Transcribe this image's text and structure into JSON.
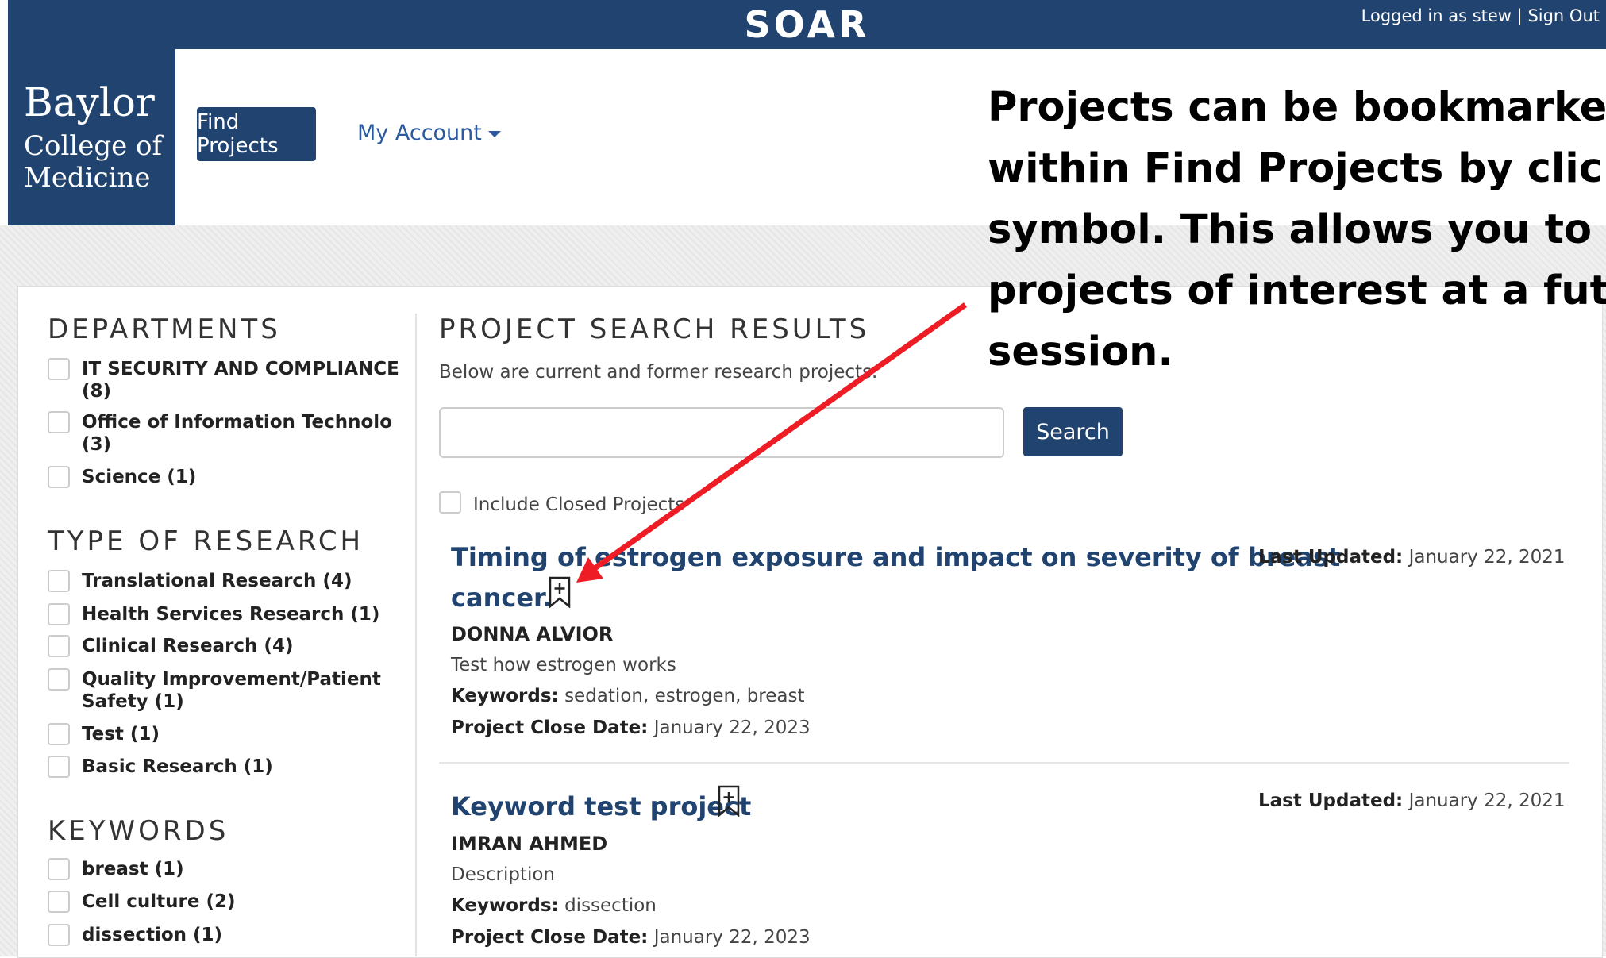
{
  "header": {
    "app_title": "SOAR",
    "logged_in_text": "Logged in as stew",
    "separator": "|",
    "sign_out": "Sign Out",
    "background_color": "#21436f"
  },
  "logo": {
    "line1": "Baylor",
    "line2": "College of",
    "line3": "Medicine"
  },
  "nav": {
    "find_projects": "Find Projects",
    "my_account": "My Account"
  },
  "sidebar": {
    "departments": {
      "title": "DEPARTMENTS",
      "items": [
        {
          "label": "IT SECURITY AND COMPLIANCE",
          "count": "(8)"
        },
        {
          "label": "Office of Information Technolo",
          "count": "(3)"
        },
        {
          "label": "Science (1)"
        }
      ]
    },
    "type_of_research": {
      "title": "TYPE OF RESEARCH",
      "items": [
        {
          "label": "Translational Research (4)"
        },
        {
          "label": "Health Services Research (1)"
        },
        {
          "label": "Clinical Research (4)"
        },
        {
          "label": "Quality Improvement/Patient",
          "label2": "Safety (1)"
        },
        {
          "label": "Test (1)"
        },
        {
          "label": "Basic Research (1)"
        }
      ]
    },
    "keywords": {
      "title": "KEYWORDS",
      "items": [
        {
          "label": "breast (1)"
        },
        {
          "label": "Cell culture (2)"
        },
        {
          "label": "dissection (1)"
        }
      ]
    }
  },
  "results": {
    "title": "PROJECT SEARCH RESULTS",
    "subtitle": "Below are current and former research projects.",
    "search_button": "Search",
    "search_placeholder": "",
    "include_closed": "Include Closed Projects",
    "projects": [
      {
        "title_line1": "Timing of estrogen exposure and impact on severity of breast",
        "title_line2": "cancer.",
        "pi": "DONNA ALVIOR",
        "description": "Test how estrogen works",
        "keywords_label": "Keywords:",
        "keywords": "sedation, estrogen, breast",
        "close_label": "Project Close Date:",
        "close_date": "January 22, 2023",
        "updated_label": "Last Updated:",
        "updated": "January 22, 2021"
      },
      {
        "title_line1": "Keyword test project",
        "pi": "IMRAN AHMED",
        "description": "Description",
        "keywords_label": "Keywords:",
        "keywords": "dissection",
        "close_label": "Project Close Date:",
        "close_date": "January 22, 2023",
        "updated_label": "Last Updated:",
        "updated": "January 22, 2021"
      }
    ]
  },
  "annotation": {
    "lines": [
      "Projects can be bookmarked f",
      "within Find Projects by clickin",
      "symbol.  This allows you to re",
      "projects of interest at a future",
      "session."
    ],
    "arrow_color": "#ee1c24"
  }
}
